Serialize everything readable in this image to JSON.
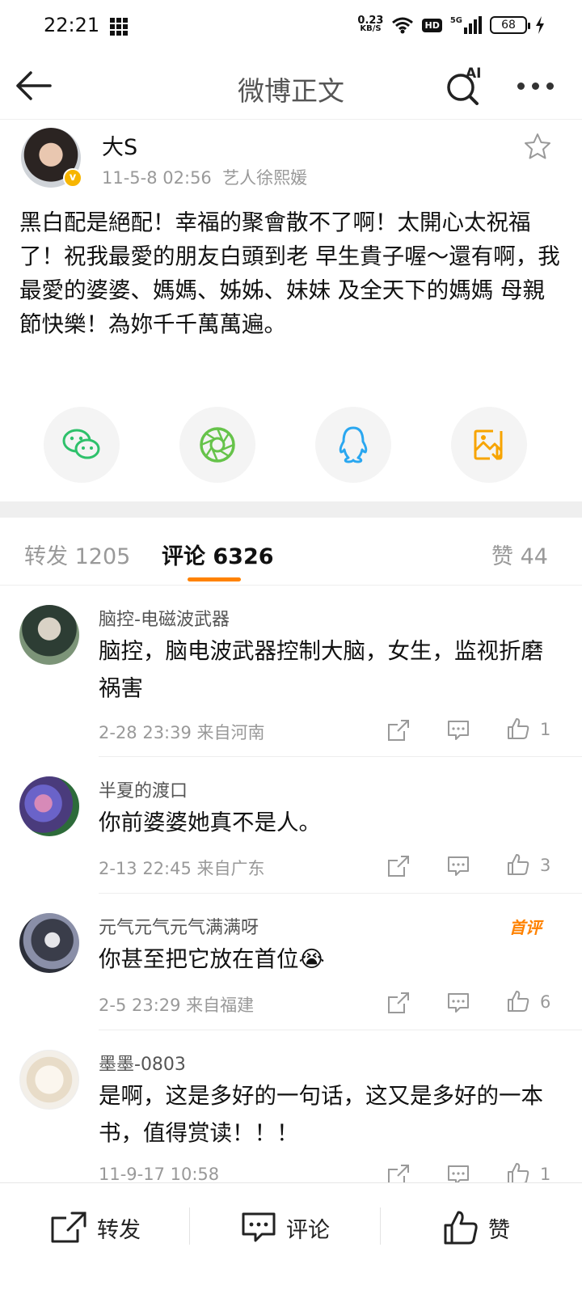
{
  "status_bar": {
    "time": "22:21",
    "net_speed": "0.23",
    "net_unit": "KB/S",
    "hd": "HD",
    "signal": "5G",
    "battery": "68"
  },
  "nav": {
    "title": "微博正文",
    "ai_label": "AI"
  },
  "post": {
    "author": "大S",
    "date": "11-5-8 02:56",
    "source": "艺人徐熙媛",
    "text": "黑白配是絕配！幸福的聚會散不了啊！太開心太祝福了！祝我最愛的朋友白頭到老 早生貴子喔～還有啊，我最愛的婆婆、媽媽、姊姊、妹妹 及全天下的媽媽 母親節快樂！為妳千千萬萬遍。"
  },
  "share_icons": [
    "wechat-icon",
    "moments-icon",
    "qq-icon",
    "save-image-icon"
  ],
  "colors": {
    "accent": "#ff8200",
    "wechat": "#2ec16b",
    "moments": "#66c34a",
    "qq": "#2aa7f0",
    "save": "#f7a400"
  },
  "tabs": {
    "repost": "转发 1205",
    "comment": "评论 6326",
    "like": "赞 44"
  },
  "comments": [
    {
      "name": "脑控-电磁波武器",
      "text": "脑控，脑电波武器控制大脑，女生，监视折磨祸害",
      "meta": "2-28 23:39  来自河南",
      "likes": "1",
      "badge": ""
    },
    {
      "name": "半夏的渡口",
      "text": "你前婆婆她真不是人。",
      "meta": "2-13 22:45  来自广东",
      "likes": "3",
      "badge": ""
    },
    {
      "name": "元气元气元气满满呀",
      "text": "你甚至把它放在首位😭",
      "meta": "2-5 23:29  来自福建",
      "likes": "6",
      "badge": "首评"
    },
    {
      "name": "墨墨-0803",
      "text": "是啊，这是多好的一句话，这又是多好的一本书，值得赏读！！！",
      "meta": "11-9-17 10:58",
      "likes": "1",
      "badge": ""
    }
  ],
  "bottom_bar": {
    "repost": "转发",
    "comment": "评论",
    "like": "赞"
  }
}
